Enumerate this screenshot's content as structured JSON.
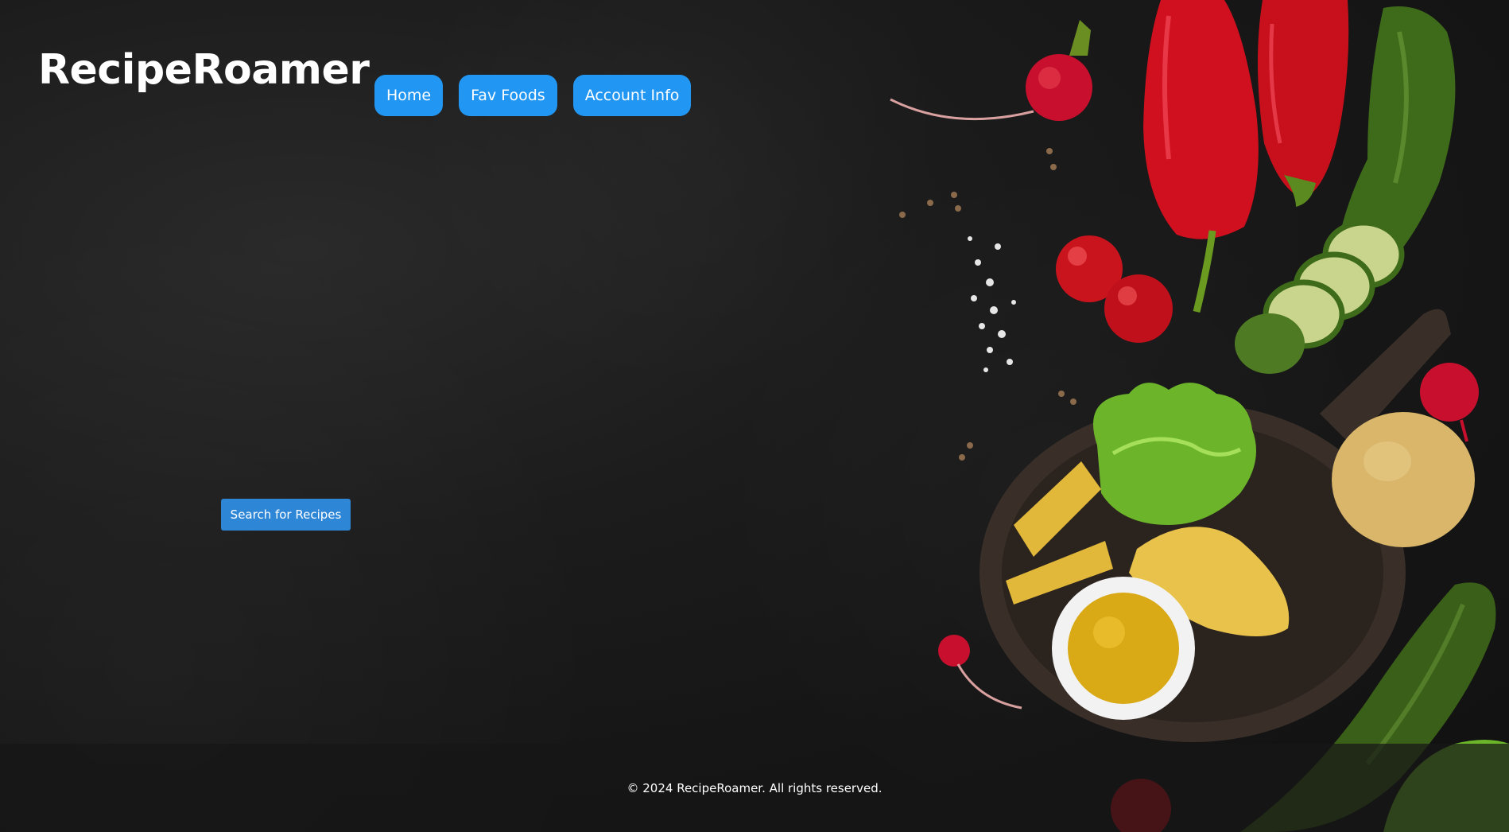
{
  "header": {
    "brand": "RecipeRoamer"
  },
  "nav": {
    "items": [
      {
        "label": "Home"
      },
      {
        "label": "Fav Foods"
      },
      {
        "label": "Account Info"
      }
    ]
  },
  "main": {
    "search_label": "Search for Recipes"
  },
  "footer": {
    "copyright": "© 2024 RecipeRoamer. All rights reserved."
  },
  "theme": {
    "nav_button_color": "#2196f3",
    "search_button_color": "#2e86d6",
    "background_color": "#1a1a1a"
  },
  "background_image": {
    "subject": "vegetables-on-dark-table"
  }
}
